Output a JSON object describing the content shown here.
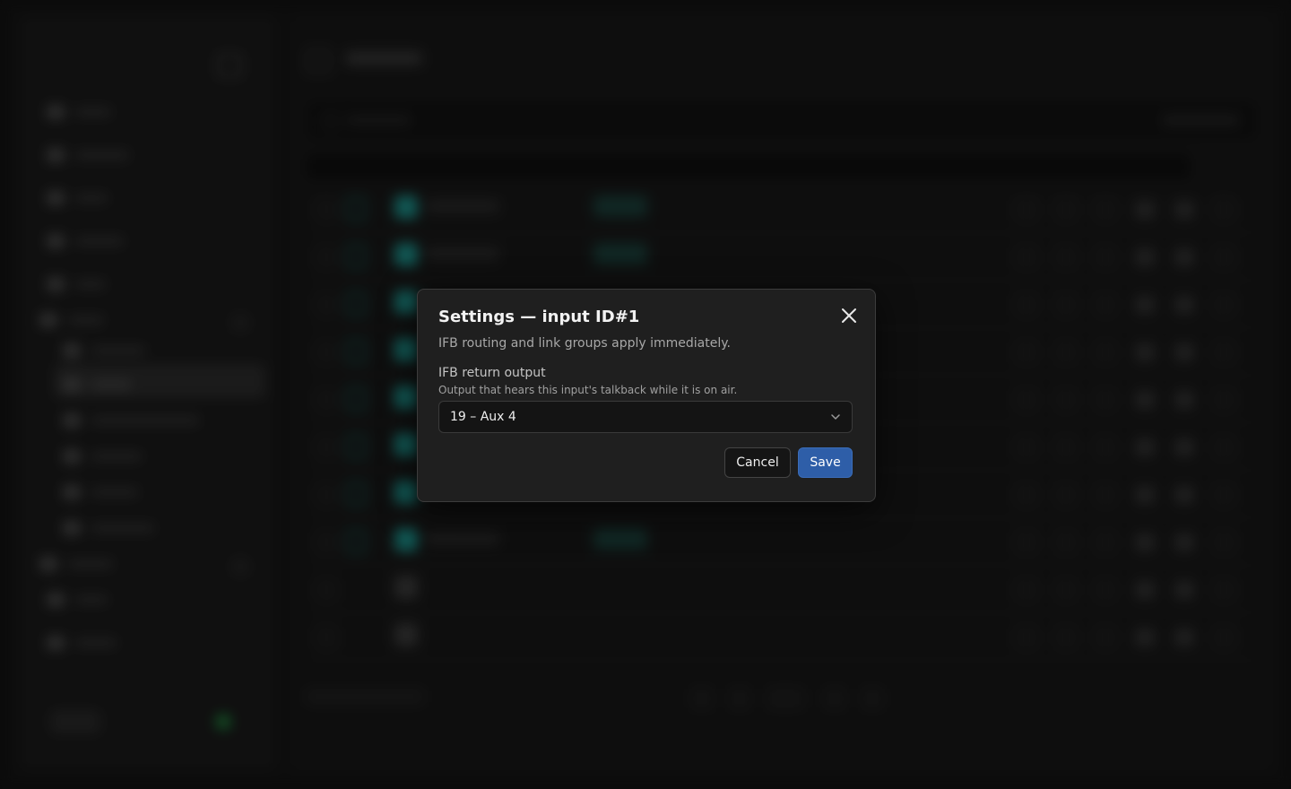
{
  "dialog": {
    "title": "Settings — input ID#1",
    "description": "IFB routing and link groups apply immediately.",
    "field": {
      "label": "IFB return output",
      "help": "Output that hears this input's talkback while it is on air.",
      "selected_value": "19 – Aux 4"
    },
    "buttons": {
      "cancel": "Cancel",
      "save": "Save"
    },
    "close_icon": "close-icon"
  },
  "colors": {
    "accent": "#2e5ea8",
    "teal": "#1c8c86",
    "status_green": "#1f7a3a"
  }
}
